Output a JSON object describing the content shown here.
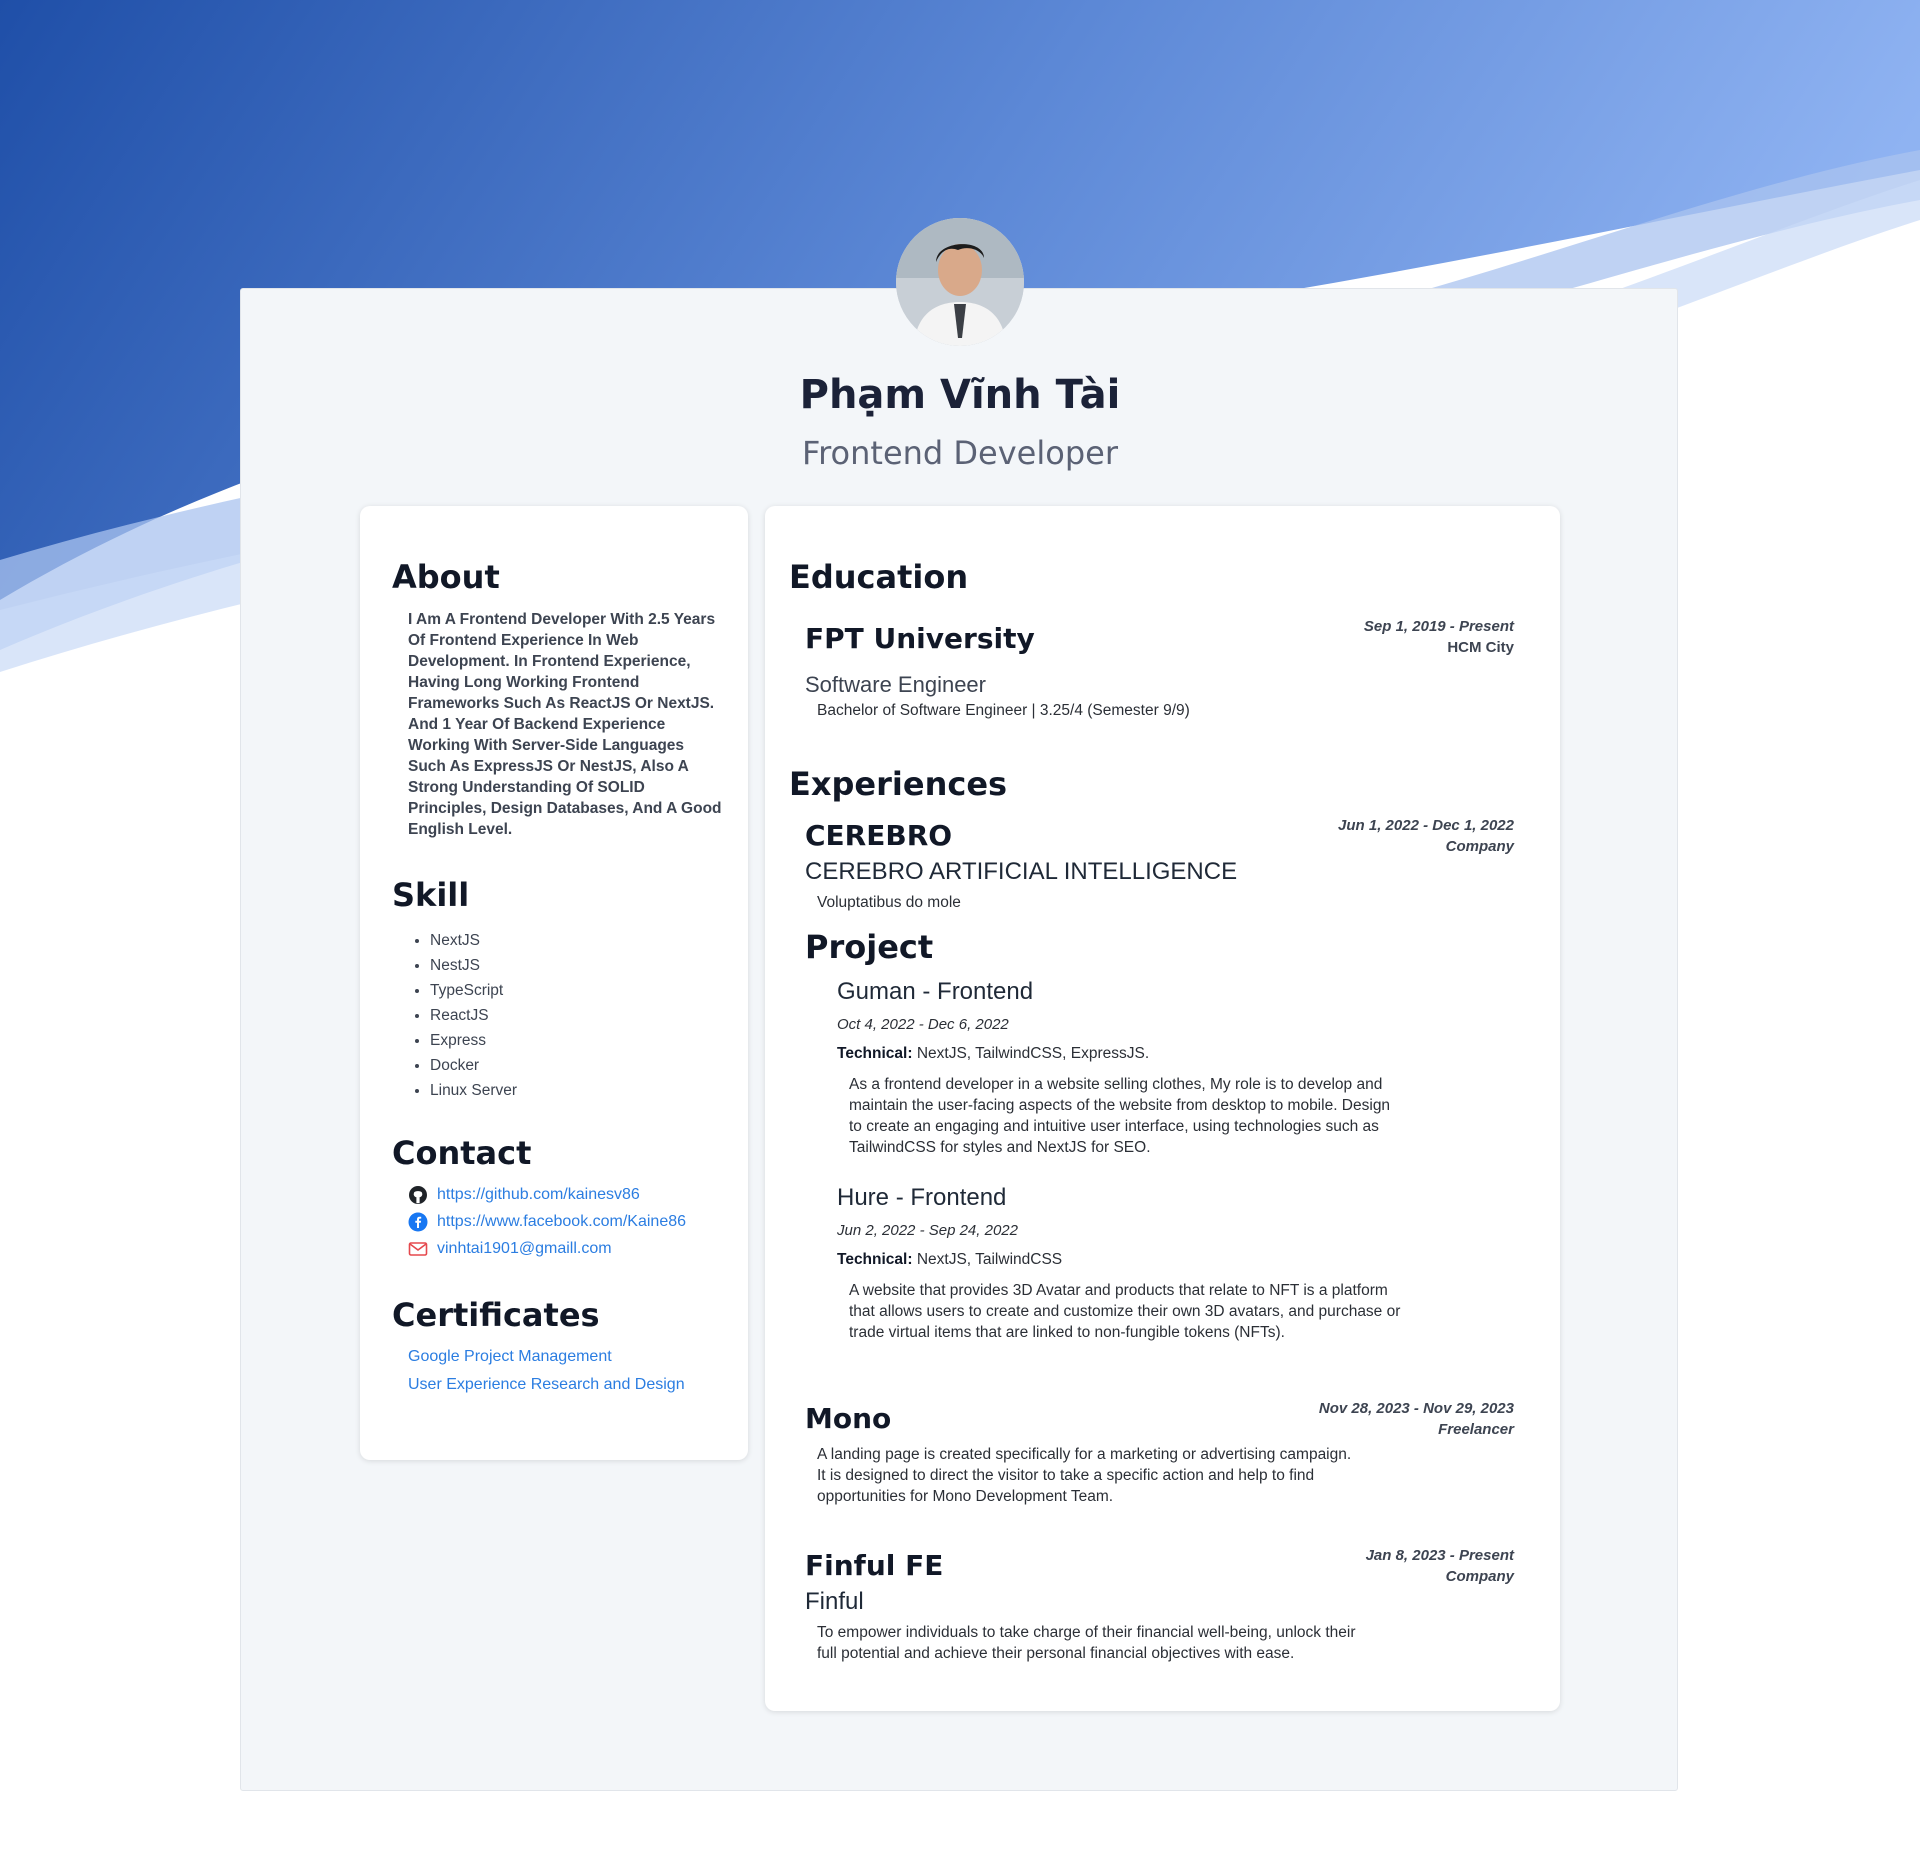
{
  "profile": {
    "name": "Phạm Vĩnh Tài",
    "role": "Frontend Developer"
  },
  "colors": {
    "hero_start": "#1f4fa8",
    "hero_end": "#8fb3f2",
    "link": "#2b7de1",
    "sheet_bg": "#f3f6f9"
  },
  "about": {
    "title": "About",
    "lines": [
      "I Am A Frontend Developer With 2.5 Years",
      "Of Frontend Experience In Web",
      "Development. In Frontend Experience,",
      "Having Long Working Frontend",
      "Frameworks Such As ReactJS Or NextJS.",
      "And 1 Year Of Backend Experience",
      "Working With Server-Side Languages",
      "Such As ExpressJS Or NestJS, Also A",
      "Strong Understanding Of SOLID",
      "Principles, Design Databases, And A Good",
      "English Level."
    ]
  },
  "skill": {
    "title": "Skill",
    "items": [
      "NextJS",
      "NestJS",
      "TypeScript",
      "ReactJS",
      "Express",
      "Docker",
      "Linux Server"
    ]
  },
  "contact": {
    "title": "Contact",
    "github": {
      "text": "https://github.com/kainesv86",
      "icon": "github-icon"
    },
    "facebook": {
      "text": "https://www.facebook.com/Kaine86",
      "icon": "facebook-icon"
    },
    "email": {
      "text": "vinhtai1901@gmaill.com",
      "icon": "mail-icon"
    }
  },
  "certificates": {
    "title": "Certificates",
    "items": [
      "Google Project Management",
      "User Experience Research and Design"
    ]
  },
  "education": {
    "title": "Education",
    "school": "FPT University",
    "date": "Sep 1, 2019 - Present",
    "location": "HCM City",
    "major": "Software Engineer",
    "detail": "Bachelor of Software Engineer | 3.25/4 (Semester 9/9)"
  },
  "experiences": {
    "title": "Experiences",
    "items": [
      {
        "name": "CEREBRO",
        "date": "Jun 1, 2022 - Dec 1, 2022",
        "type": "Company",
        "company": "CEREBRO ARTIFICIAL INTELLIGENCE",
        "desc": "Voluptatibus do mole"
      },
      {
        "name": "Mono",
        "date": "Nov 28, 2023 - Nov 29, 2023",
        "type": "Freelancer",
        "desc_lines": [
          "A landing page is created specifically for a marketing or advertising campaign.",
          "It is designed to direct the visitor to take a specific action and help to find",
          "opportunities for Mono Development Team."
        ]
      },
      {
        "name": "Finful FE",
        "date": "Jan 8, 2023 - Present",
        "type": "Company",
        "company": "Finful",
        "desc_lines": [
          "To empower individuals to take charge of their financial well-being, unlock their",
          "full potential and achieve their personal financial objectives with ease."
        ]
      }
    ]
  },
  "project": {
    "title": "Project",
    "technical_label": "Technical:",
    "items": [
      {
        "title": "Guman - Frontend",
        "date": "Oct 4, 2022 - Dec 6, 2022",
        "technical": "NextJS, TailwindCSS, ExpressJS.",
        "desc_lines": [
          "As a frontend developer in a website selling clothes, My role is to develop and",
          "maintain the user-facing aspects of the website from desktop to mobile. Design",
          "to create an engaging and intuitive user interface, using technologies such as",
          "TailwindCSS for styles and NextJS for SEO."
        ]
      },
      {
        "title": "Hure - Frontend",
        "date": "Jun 2, 2022 - Sep 24, 2022",
        "technical": "NextJS, TailwindCSS",
        "desc_lines": [
          "A website that provides 3D Avatar and products that relate to NFT is a platform",
          "that allows users to create and customize their own 3D avatars, and purchase or",
          "trade virtual items that are linked to non-fungible tokens (NFTs)."
        ]
      }
    ]
  }
}
